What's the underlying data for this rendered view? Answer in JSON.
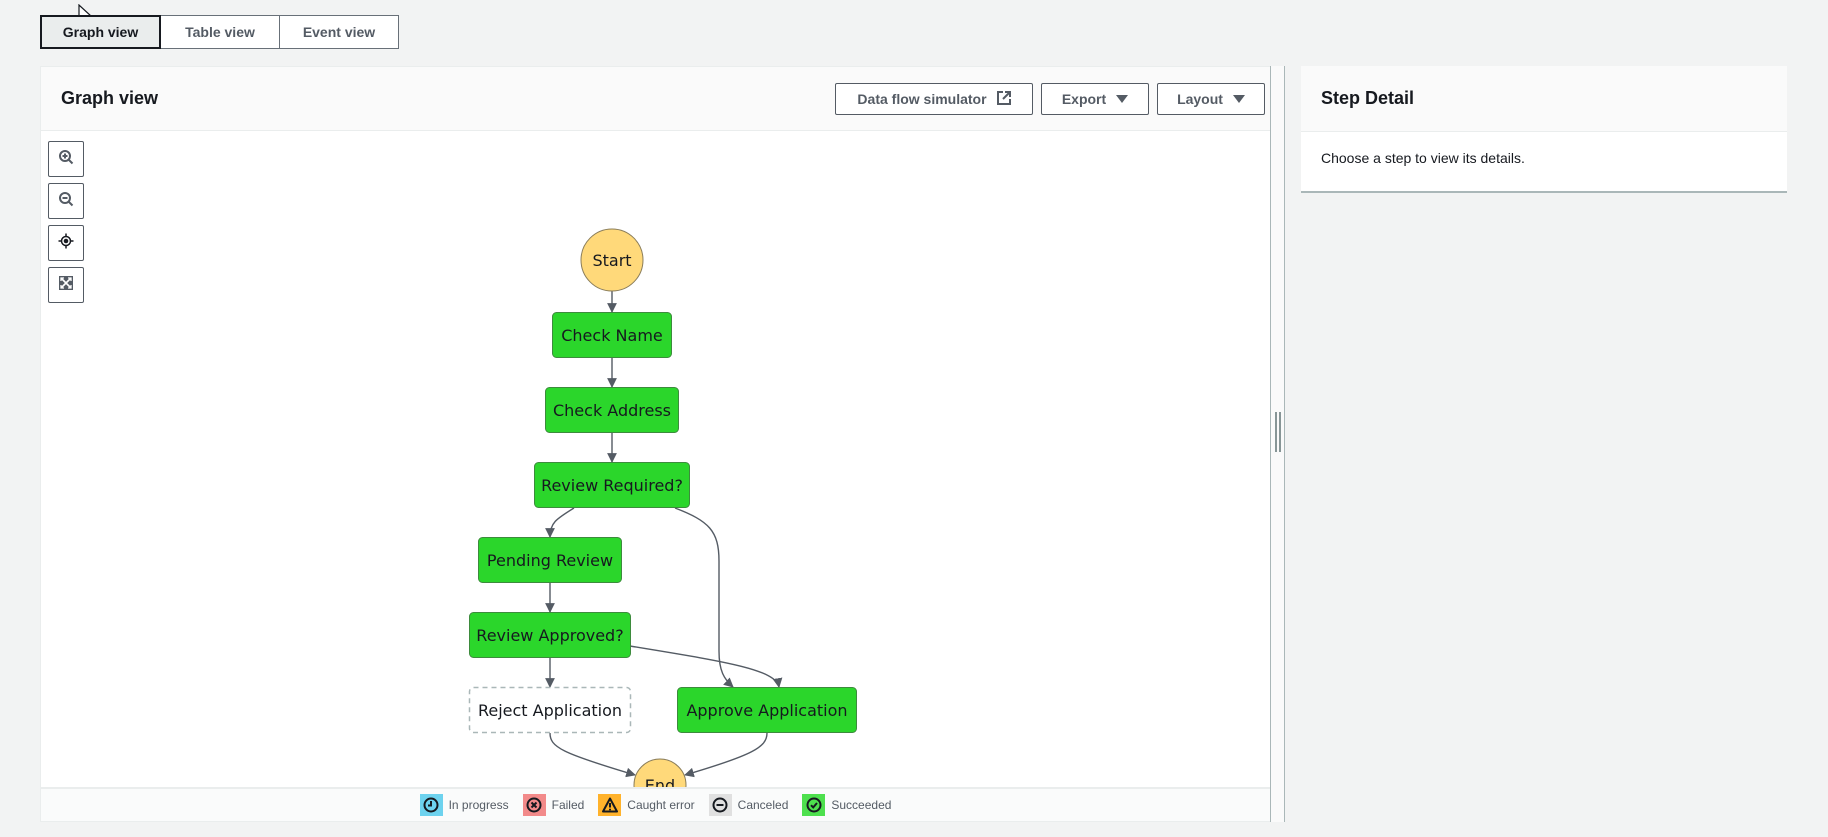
{
  "tabs": [
    {
      "label": "Graph view",
      "active": true
    },
    {
      "label": "Table view",
      "active": false
    },
    {
      "label": "Event view",
      "active": false
    }
  ],
  "graph_panel": {
    "title": "Graph view",
    "actions": {
      "data_flow_simulator": "Data flow simulator",
      "export": "Export",
      "layout": "Layout"
    },
    "zoom_controls": [
      "zoom-in",
      "zoom-out",
      "center",
      "fit-to-screen"
    ]
  },
  "graph": {
    "nodes": [
      {
        "id": "start",
        "label": "Start",
        "type": "terminal",
        "status": "none"
      },
      {
        "id": "check-name",
        "label": "Check Name",
        "type": "task",
        "status": "succeeded"
      },
      {
        "id": "check-address",
        "label": "Check Address",
        "type": "task",
        "status": "succeeded"
      },
      {
        "id": "review-required",
        "label": "Review Required?",
        "type": "choice",
        "status": "succeeded"
      },
      {
        "id": "pending-review",
        "label": "Pending Review",
        "type": "task",
        "status": "succeeded"
      },
      {
        "id": "review-approved",
        "label": "Review Approved?",
        "type": "choice",
        "status": "succeeded"
      },
      {
        "id": "reject-application",
        "label": "Reject Application",
        "type": "task",
        "status": "not-executed"
      },
      {
        "id": "approve-application",
        "label": "Approve Application",
        "type": "task",
        "status": "succeeded"
      },
      {
        "id": "end",
        "label": "End",
        "type": "terminal",
        "status": "none"
      }
    ],
    "edges": [
      [
        "start",
        "check-name"
      ],
      [
        "check-name",
        "check-address"
      ],
      [
        "check-address",
        "review-required"
      ],
      [
        "review-required",
        "pending-review"
      ],
      [
        "review-required",
        "approve-application"
      ],
      [
        "pending-review",
        "review-approved"
      ],
      [
        "review-approved",
        "reject-application"
      ],
      [
        "review-approved",
        "approve-application"
      ],
      [
        "reject-application",
        "end"
      ],
      [
        "approve-application",
        "end"
      ]
    ],
    "colors": {
      "succeeded": "#2bd62b",
      "terminal": "#ffd97a",
      "edge": "#545b64"
    }
  },
  "legend": [
    {
      "label": "In progress",
      "icon": "clock-icon",
      "color": "#6dd2ee"
    },
    {
      "label": "Failed",
      "icon": "x-circle-icon",
      "color": "#f28a8a"
    },
    {
      "label": "Caught error",
      "icon": "warning-icon",
      "color": "#ffb22b"
    },
    {
      "label": "Canceled",
      "icon": "minus-circle-icon",
      "color": "#e0e0e0"
    },
    {
      "label": "Succeeded",
      "icon": "check-circle-icon",
      "color": "#4ee04e"
    }
  ],
  "step_detail": {
    "title": "Step Detail",
    "message": "Choose a step to view its details."
  }
}
